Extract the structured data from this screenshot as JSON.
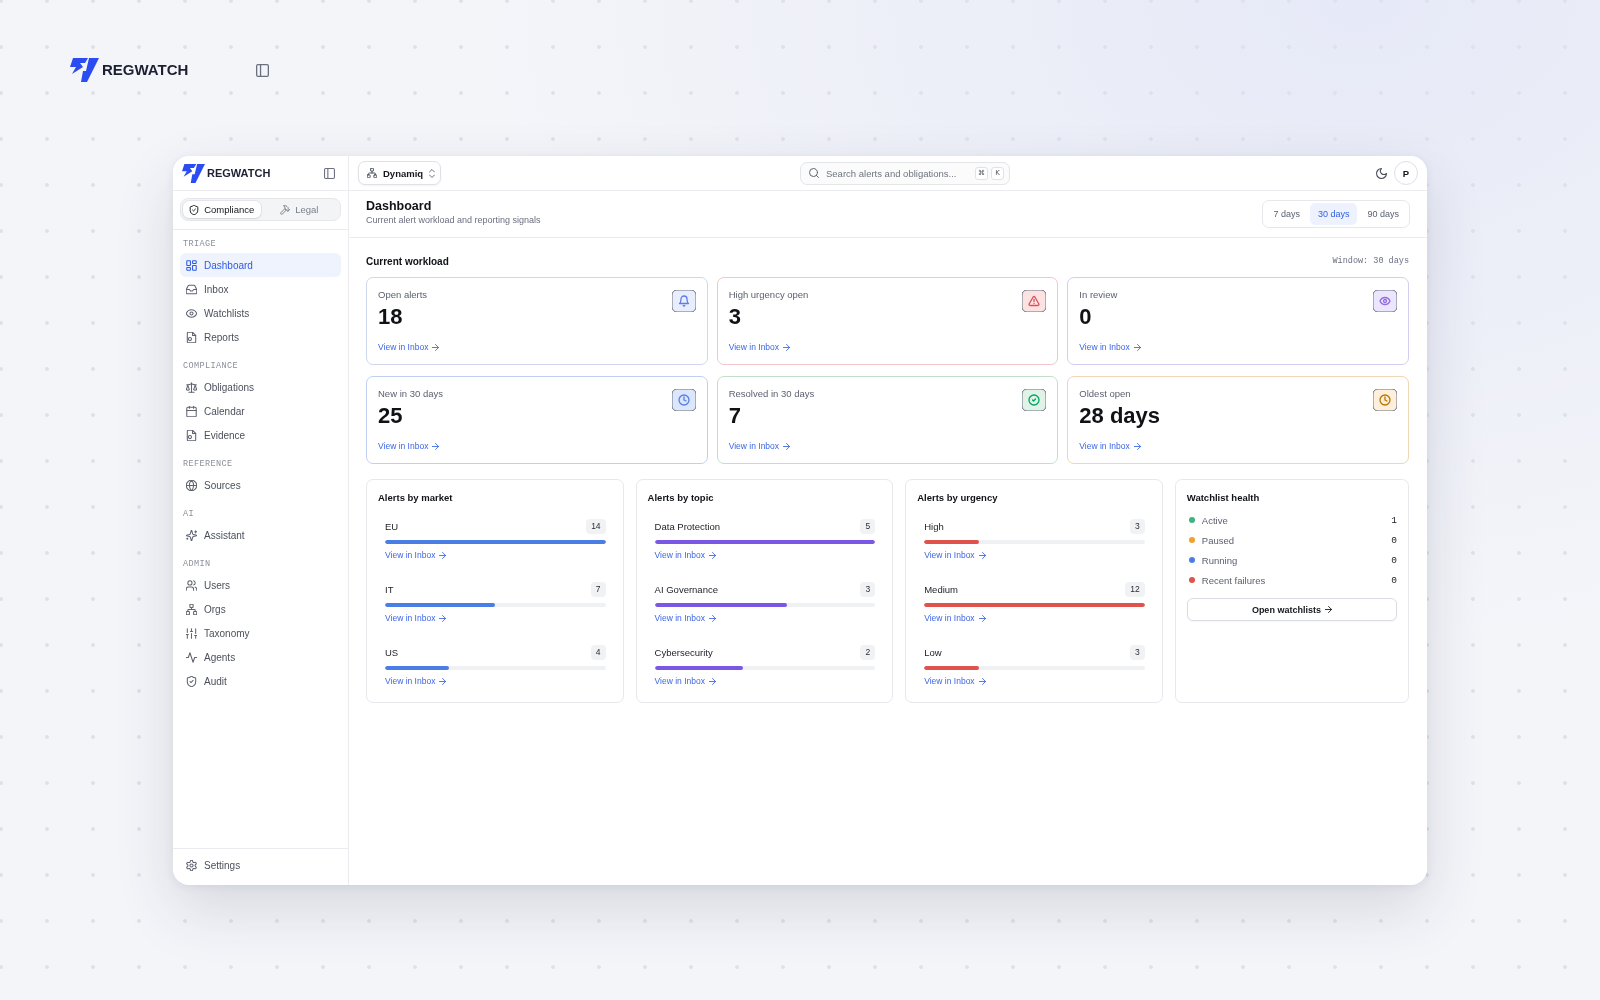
{
  "backdrop": {
    "brand": "REGWATCH"
  },
  "sidebar": {
    "brand": "REGWATCH",
    "modes": [
      {
        "label": "Compliance",
        "selected": true
      },
      {
        "label": "Legal",
        "selected": false
      }
    ],
    "sections": [
      {
        "title": "TRIAGE",
        "items": [
          {
            "label": "Dashboard",
            "selected": true
          },
          {
            "label": "Inbox",
            "selected": false
          },
          {
            "label": "Watchlists",
            "selected": false
          },
          {
            "label": "Reports",
            "selected": false
          }
        ]
      },
      {
        "title": "COMPLIANCE",
        "items": [
          {
            "label": "Obligations",
            "selected": false
          },
          {
            "label": "Calendar",
            "selected": false
          },
          {
            "label": "Evidence",
            "selected": false
          }
        ]
      },
      {
        "title": "REFERENCE",
        "items": [
          {
            "label": "Sources",
            "selected": false
          }
        ]
      },
      {
        "title": "AI",
        "items": [
          {
            "label": "Assistant",
            "selected": false
          }
        ]
      },
      {
        "title": "ADMIN",
        "items": [
          {
            "label": "Users",
            "selected": false
          },
          {
            "label": "Orgs",
            "selected": false
          },
          {
            "label": "Taxonomy",
            "selected": false
          },
          {
            "label": "Agents",
            "selected": false
          },
          {
            "label": "Audit",
            "selected": false
          }
        ]
      }
    ],
    "footer": {
      "label": "Settings"
    }
  },
  "header": {
    "org": "Dynamiq",
    "search": {
      "placeholder": "Search alerts and obligations..."
    },
    "shortcut_keys": [
      "⌘",
      "K"
    ],
    "avatar": "P"
  },
  "page": {
    "title": "Dashboard",
    "subtitle": "Current alert workload and reporting signals",
    "ranges": [
      {
        "label": "7 days",
        "selected": false
      },
      {
        "label": "30 days",
        "selected": true
      },
      {
        "label": "90 days",
        "selected": false
      }
    ]
  },
  "workload": {
    "title": "Current workload",
    "window": "Window: 30 days",
    "cards": [
      {
        "label": "Open alerts",
        "value": "18",
        "link": "View in Inbox",
        "color": "#e8eefd"
      },
      {
        "label": "High urgency open",
        "value": "3",
        "link": "View in Inbox",
        "color": "#fde2e2"
      },
      {
        "label": "In review",
        "value": "0",
        "link": "View in Inbox",
        "color": "#ebe6fd"
      },
      {
        "label": "New in 30 days",
        "value": "25",
        "link": "View in Inbox",
        "color": "#dde7fc"
      },
      {
        "label": "Resolved in 30 days",
        "value": "7",
        "link": "View in Inbox",
        "color": "#e1f3e8"
      },
      {
        "label": "Oldest open",
        "value": "28 days",
        "link": "View in Inbox",
        "color": "#fdefd9"
      }
    ]
  },
  "panels": [
    {
      "title": "Alerts by market",
      "color": "#4a7ee6",
      "rows": [
        {
          "label": "EU",
          "count": "14",
          "level": 1,
          "link": "View in Inbox"
        },
        {
          "label": "IT",
          "count": "7",
          "level": 0.5,
          "link": "View in Inbox"
        },
        {
          "label": "US",
          "count": "4",
          "level": 0.29,
          "link": "View in Inbox"
        }
      ]
    },
    {
      "title": "Alerts by topic",
      "color": "#7b57e6",
      "rows": [
        {
          "label": "Data Protection",
          "count": "5",
          "level": 1,
          "link": "View in Inbox"
        },
        {
          "label": "AI Governance",
          "count": "3",
          "level": 0.6,
          "link": "View in Inbox"
        },
        {
          "label": "Cybersecurity",
          "count": "2",
          "level": 0.4,
          "link": "View in Inbox"
        }
      ]
    },
    {
      "title": "Alerts by urgency",
      "color": "#e0524c",
      "rows": [
        {
          "label": "High",
          "count": "3",
          "level": 0.25,
          "link": "View in Inbox"
        },
        {
          "label": "Medium",
          "count": "12",
          "level": 1,
          "link": "View in Inbox"
        },
        {
          "label": "Low",
          "count": "3",
          "level": 0.25,
          "link": "View in Inbox"
        }
      ]
    }
  ],
  "watchlist_health": {
    "title": "Watchlist health",
    "rows": [
      {
        "label": "Active",
        "count": "1",
        "color": "#3fb37f"
      },
      {
        "label": "Paused",
        "count": "0",
        "color": "#f0a030"
      },
      {
        "label": "Running",
        "count": "0",
        "color": "#4a7ee6"
      },
      {
        "label": "Recent failures",
        "count": "0",
        "color": "#e0524c"
      }
    ],
    "button": "Open watchlists"
  }
}
